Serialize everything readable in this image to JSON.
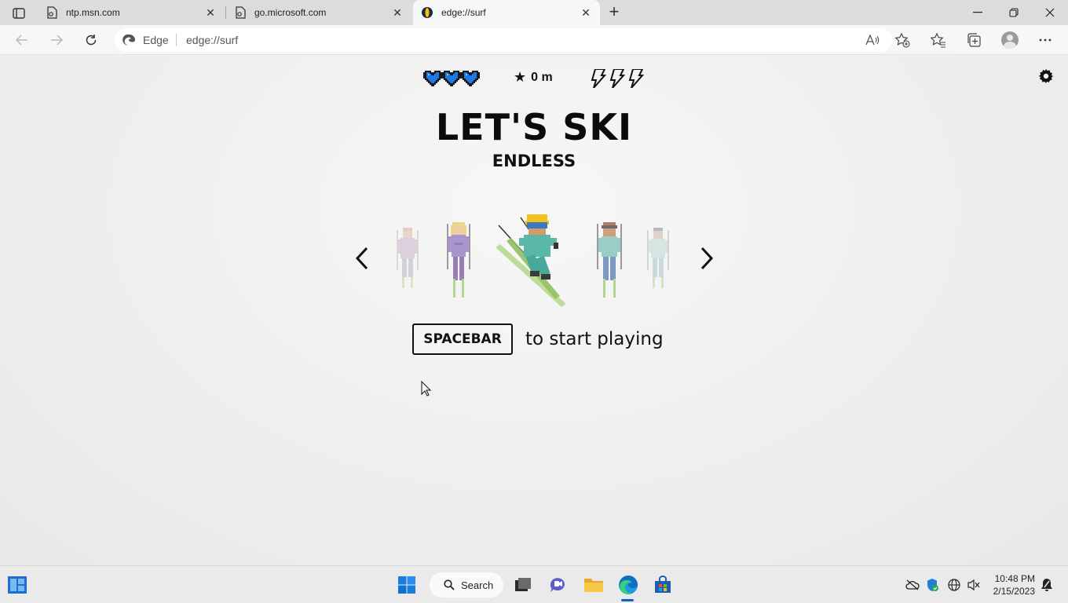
{
  "browser": {
    "tabs": [
      {
        "title": "ntp.msn.com",
        "active": false
      },
      {
        "title": "go.microsoft.com",
        "active": false
      },
      {
        "title": "edge://surf",
        "active": true
      }
    ],
    "omnibox": {
      "label": "Edge",
      "url": "edge://surf"
    }
  },
  "game": {
    "lives": 3,
    "boosts": 3,
    "distance": "0 m",
    "title": "LET'S SKI",
    "mode": "ENDLESS",
    "start_key": "SPACEBAR",
    "start_text": "to start playing",
    "characters": [
      "skier-1",
      "skier-2",
      "skier-selected",
      "skier-4",
      "skier-5"
    ],
    "selected_character_index": 2
  },
  "taskbar": {
    "search_label": "Search",
    "time": "10:48 PM",
    "date": "2/15/2023"
  },
  "colors": {
    "heart": "#1e7be6",
    "accent": "#0a64c8"
  }
}
